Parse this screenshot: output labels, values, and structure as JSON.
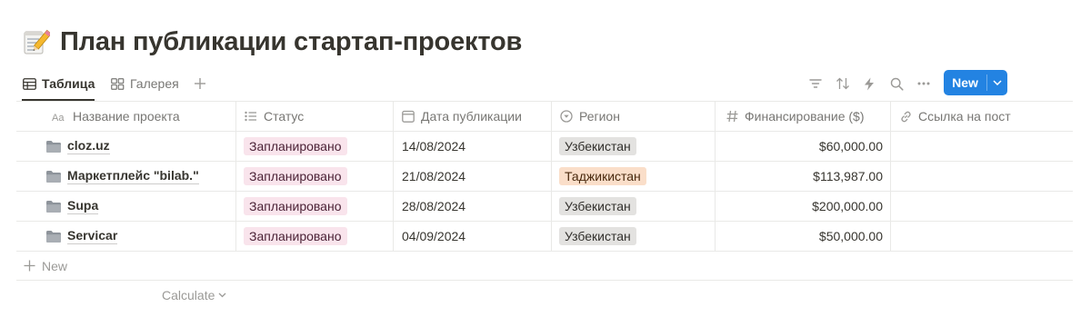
{
  "page": {
    "title": "План публикации стартап-проектов",
    "title_icon": "memo-pencil-emoji"
  },
  "views": {
    "tabs": [
      {
        "label": "Таблица",
        "icon": "table-icon",
        "active": true
      },
      {
        "label": "Галерея",
        "icon": "gallery-icon",
        "active": false
      }
    ],
    "add_icon": "plus-icon"
  },
  "toolbar": {
    "icons": [
      "filter-icon",
      "sort-icon",
      "automation-bolt-icon",
      "search-icon",
      "more-icon"
    ],
    "new_label": "New",
    "new_chevron": "chevron-down-icon",
    "accent_color": "#2383e2"
  },
  "table": {
    "columns": [
      {
        "label": "Название проекта",
        "icon": "text-aa-icon"
      },
      {
        "label": "Статус",
        "icon": "list-icon"
      },
      {
        "label": "Дата публикации",
        "icon": "calendar-icon"
      },
      {
        "label": "Регион",
        "icon": "select-circle-icon"
      },
      {
        "label": "Финансирование ($)",
        "icon": "hash-icon"
      },
      {
        "label": "Ссылка на пост",
        "icon": "link-icon"
      }
    ],
    "rows": [
      {
        "name": "cloz.uz",
        "status": "Запланировано",
        "date": "14/08/2024",
        "region": "Узбекистан",
        "region_color": "gray",
        "funding": "$60,000.00",
        "link": ""
      },
      {
        "name": "Маркетплейс \"bilab.\"",
        "status": "Запланировано",
        "date": "21/08/2024",
        "region": "Таджикистан",
        "region_color": "orange",
        "funding": "$113,987.00",
        "link": ""
      },
      {
        "name": "Supa",
        "status": "Запланировано",
        "date": "28/08/2024",
        "region": "Узбекистан",
        "region_color": "gray",
        "funding": "$200,000.00",
        "link": ""
      },
      {
        "name": "Servicar",
        "status": "Запланировано",
        "date": "04/09/2024",
        "region": "Узбекистан",
        "region_color": "gray",
        "funding": "$50,000.00",
        "link": ""
      }
    ],
    "new_row_label": "New",
    "calculate_label": "Calculate",
    "tag_colors": {
      "pink": "#f9e4ec",
      "gray": "#e3e2e0",
      "orange": "#fadec9"
    },
    "row_icon": "folder-icon"
  }
}
